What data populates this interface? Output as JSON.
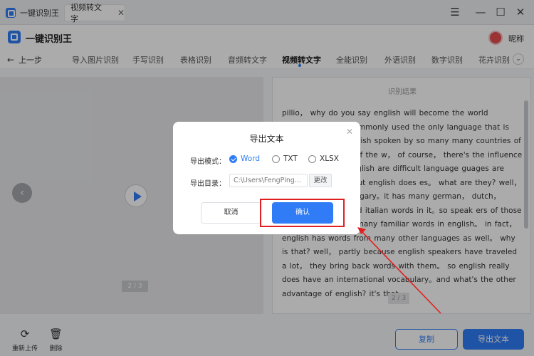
{
  "window": {
    "tab1_label": "一键识别王",
    "tab2_label": "视频转文字"
  },
  "header": {
    "app_name": "一键识别王",
    "user_name": "昵称"
  },
  "nav": {
    "back_label": "上一步",
    "items": [
      "导入图片识别",
      "手写识别",
      "表格识别",
      "音频转文字",
      "视频转文字",
      "全能识别",
      "外语识别",
      "数字识别",
      "花卉识别"
    ],
    "active_index": 4
  },
  "video": {
    "page_indicator": "2 / 3"
  },
  "result": {
    "title": "识别结果",
    "page_indicator": "2 / 3",
    "text": "pillio， why do you say english will become the world language? it's so commonly used the only language that is chinese。why if english spoken by so many many countries of the world because of the w， of course， there's the influence of stuguage find english are difficult language guages are difficult to learn， but english does es。 what are they? well， first table? it has aitgary。it has many german， dutch， french， spanish and italian words in it。so speak ers of those languages will find many familiar words in english。 in fact， english has words from many other languages as well。 why is that? well， partly because english speakers have traveled a lot， they bring back words with them。 so english really does have an international vocabulary。and what's the other advantage of english? it's that"
  },
  "bottom": {
    "reupload_label": "重新上传",
    "delete_label": "删除",
    "copy_label": "复制",
    "export_label": "导出文本"
  },
  "dialog": {
    "title": "导出文本",
    "mode_label": "导出模式：",
    "modes": [
      "Word",
      "TXT",
      "XLSX"
    ],
    "selected_mode": "Word",
    "dir_label": "导出目录：",
    "dir_value": "C:\\Users\\FengPing...",
    "change_label": "更改",
    "cancel_label": "取消",
    "confirm_label": "确认"
  },
  "colors": {
    "accent": "#2f7cf6",
    "highlight": "#e02020"
  }
}
